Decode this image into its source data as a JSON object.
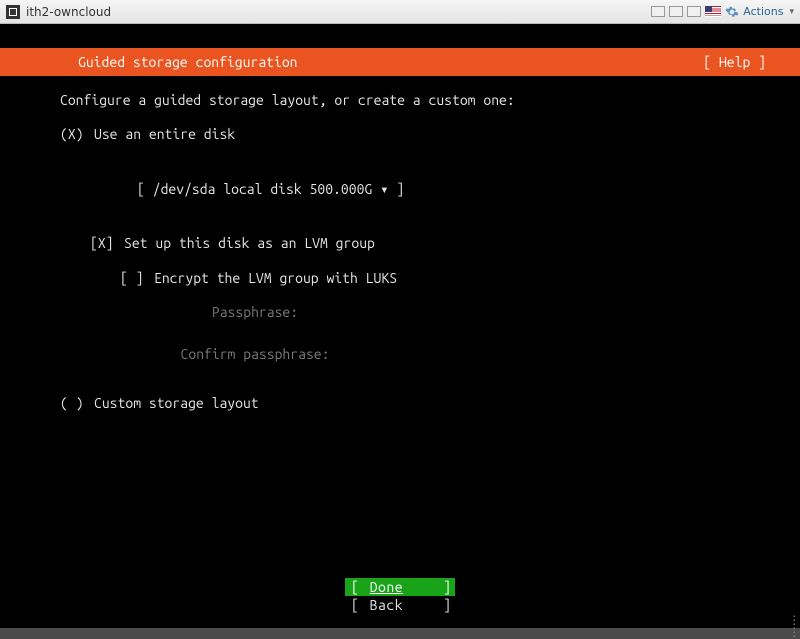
{
  "window": {
    "title": "ith2-owncloud",
    "actions_label": "Actions"
  },
  "header": {
    "title": "Guided storage configuration",
    "help_label": "[ Help ]"
  },
  "body": {
    "intro": "Configure a guided storage layout, or create a custom one:",
    "opt_entire": {
      "mark": "(X)",
      "label": "Use an entire disk"
    },
    "disk_select": "[ /dev/sda local disk 500.000G ▾ ]",
    "opt_lvm": {
      "mark": "[X]",
      "label": "Set up this disk as an LVM group"
    },
    "opt_encrypt": {
      "mark": "[ ]",
      "label": "Encrypt the LVM group with LUKS"
    },
    "passphrase_label": "Passphrase:",
    "confirm_label": "Confirm passphrase:",
    "opt_custom": {
      "mark": "( )",
      "label": "Custom storage layout"
    }
  },
  "footer": {
    "done": "Done",
    "back": "Back"
  }
}
